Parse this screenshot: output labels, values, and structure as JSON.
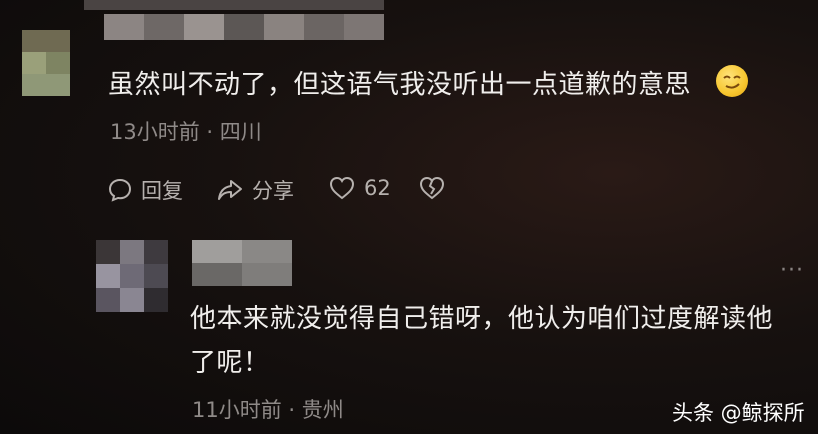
{
  "comment1": {
    "text": "虽然叫不动了，但这语气我没听出一点道歉的意思",
    "emoji_icon": "smirking-face-icon",
    "meta": "13小时前 · 四川",
    "reply_label": "回复",
    "share_label": "分享",
    "like_count": "62"
  },
  "comment2": {
    "text_line1": "他本来就没觉得自己错呀，他认为咱们过度解读他",
    "text_line2": "了呢！",
    "meta": "11小时前 · 贵州",
    "more_icon": "more-dots-icon"
  },
  "watermark": {
    "text": "头条 @鲸探所"
  }
}
